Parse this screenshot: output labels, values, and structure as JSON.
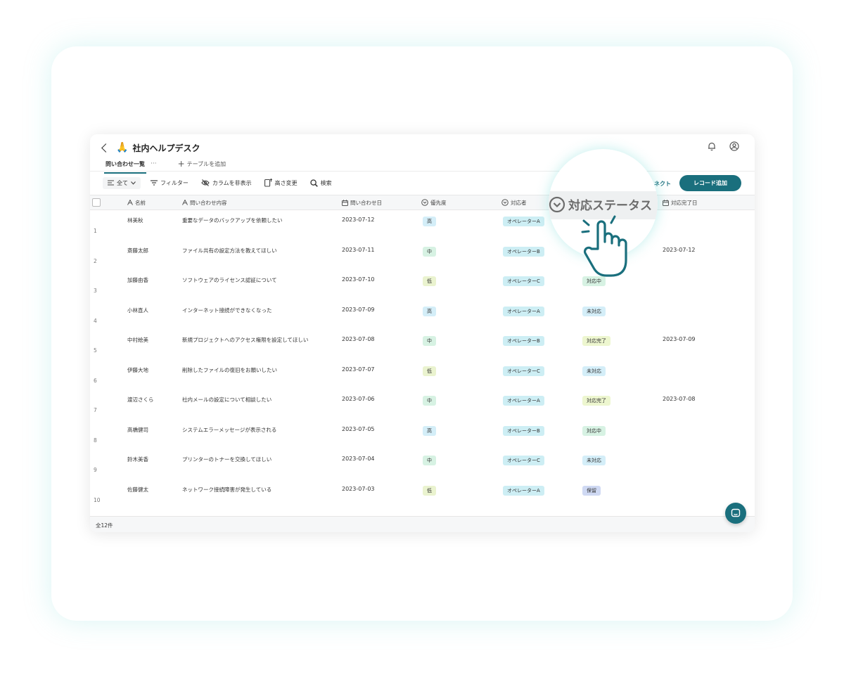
{
  "app": {
    "title": "社内ヘルプデスク",
    "icon": "folded-hands-emoji",
    "icon_glyph": "🙏"
  },
  "tabs": [
    {
      "label": "問い合わせ一覧",
      "active": true
    }
  ],
  "tab_more": "···",
  "add_table_label": "テーブルを追加",
  "toolbar": {
    "view_label": "全て",
    "filter_label": "フィルター",
    "hide_columns_label": "カラムを非表示",
    "row_height_label": "高さ変更",
    "search_label": "検索",
    "connect_label": "ネクト",
    "record_add_label": "レコード追加"
  },
  "columns": {
    "name": "名前",
    "content": "問い合わせ内容",
    "date": "問い合わせ日",
    "priority": "優先度",
    "assignee": "対応者",
    "status": "対応ステータス",
    "done_date": "対応完了日"
  },
  "rows": [
    {
      "num": "1",
      "name": "林美秋",
      "content": "重要なデータのバックアップを依頼したい",
      "date": "2023-07-12",
      "priority": "高",
      "assignee": "オペレーターA",
      "status": "",
      "done_date": ""
    },
    {
      "num": "2",
      "name": "斎藤太郎",
      "content": "ファイル共有の設定方法を教えてほしい",
      "date": "2023-07-11",
      "priority": "中",
      "assignee": "オペレーターB",
      "status": "",
      "done_date": "2023-07-12"
    },
    {
      "num": "3",
      "name": "加藤由香",
      "content": "ソフトウェアのライセンス認証について",
      "date": "2023-07-10",
      "priority": "低",
      "assignee": "オペレーターC",
      "status": "対応中",
      "done_date": ""
    },
    {
      "num": "4",
      "name": "小林直人",
      "content": "インターネット接続ができなくなった",
      "date": "2023-07-09",
      "priority": "高",
      "assignee": "オペレーターA",
      "status": "未対応",
      "done_date": ""
    },
    {
      "num": "5",
      "name": "中村絵美",
      "content": "新規プロジェクトへのアクセス権限を設定してほしい",
      "date": "2023-07-08",
      "priority": "中",
      "assignee": "オペレーターB",
      "status": "対応完了",
      "done_date": "2023-07-09"
    },
    {
      "num": "6",
      "name": "伊藤大地",
      "content": "削除したファイルの復旧をお願いしたい",
      "date": "2023-07-07",
      "priority": "低",
      "assignee": "オペレーターC",
      "status": "未対応",
      "done_date": ""
    },
    {
      "num": "7",
      "name": "渡辺さくら",
      "content": "社内メールの設定について相談したい",
      "date": "2023-07-06",
      "priority": "中",
      "assignee": "オペレーターA",
      "status": "対応完了",
      "done_date": "2023-07-08"
    },
    {
      "num": "8",
      "name": "高橋健司",
      "content": "システムエラーメッセージが表示される",
      "date": "2023-07-05",
      "priority": "高",
      "assignee": "オペレーターB",
      "status": "対応中",
      "done_date": ""
    },
    {
      "num": "9",
      "name": "鈴木美香",
      "content": "プリンターのトナーを交換してほしい",
      "date": "2023-07-04",
      "priority": "中",
      "assignee": "オペレーターC",
      "status": "未対応",
      "done_date": ""
    },
    {
      "num": "10",
      "name": "佐藤健太",
      "content": "ネットワーク接続障害が発生している",
      "date": "2023-07-03",
      "priority": "低",
      "assignee": "オペレーターA",
      "status": "保留",
      "done_date": ""
    }
  ],
  "footer": {
    "count_label": "全12件"
  },
  "magnifier": {
    "label": "対応ステータス"
  },
  "colors": {
    "accent": "#1a6f7d",
    "priority_high": "#d4eef8",
    "priority_mid": "#d7f2e3",
    "priority_low": "#eaf3cf",
    "assignee": "#cdeef4",
    "status_in_progress": "#d7f2e3",
    "status_unhandled": "#d4eef8",
    "status_done": "#edf6cf",
    "status_hold": "#cfd9f3"
  }
}
